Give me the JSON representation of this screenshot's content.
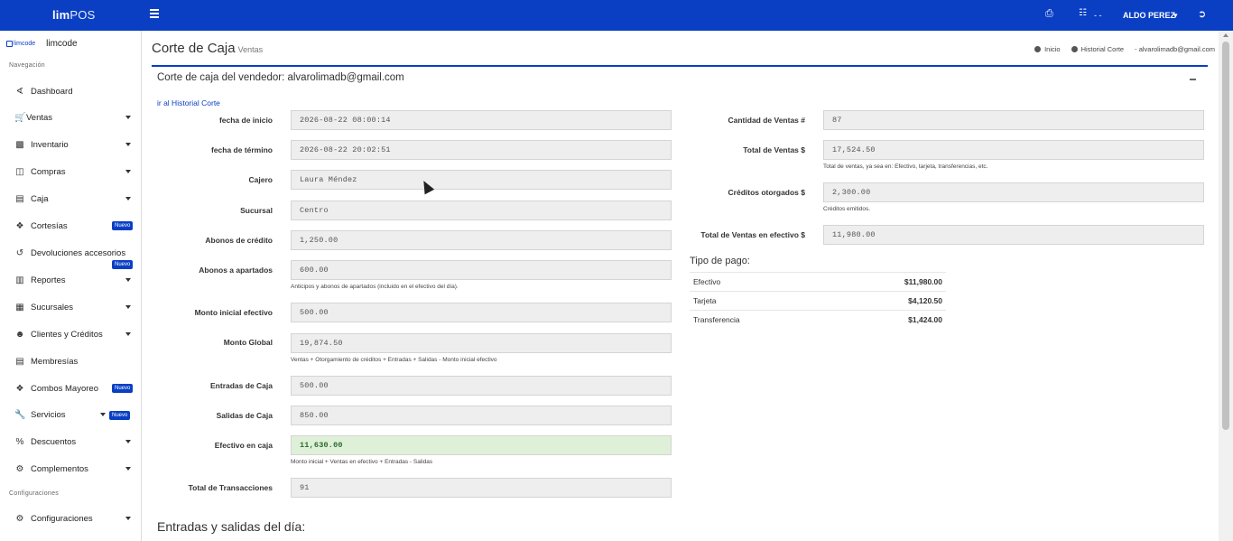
{
  "topbar": {
    "brand_bold": "lim",
    "brand_rest": "POS",
    "user": "ALDO PEREZ",
    "dots": "- -"
  },
  "sidebar": {
    "brand_logo": "limcode",
    "brand_name": "limcode",
    "nav_section": "Navegación",
    "config_section": "Configuraciones",
    "items": [
      {
        "label": "Dashboard",
        "icon": "chart-line-icon"
      },
      {
        "label": "Ventas",
        "icon": "cart-icon"
      },
      {
        "label": "Inventario",
        "icon": "boxes-icon"
      },
      {
        "label": "Compras",
        "icon": "basket-icon"
      },
      {
        "label": "Caja",
        "icon": "cash-register-icon"
      },
      {
        "label": "Cortesías",
        "icon": "gift-icon",
        "badge": "Nuevo"
      },
      {
        "label": "Devoluciones accesorios",
        "icon": "undo-icon",
        "badge": "Nuevo"
      },
      {
        "label": "Reportes",
        "icon": "bar-chart-icon"
      },
      {
        "label": "Sucursales",
        "icon": "building-icon"
      },
      {
        "label": "Clientes y Créditos",
        "icon": "users-icon"
      },
      {
        "label": "Membresías",
        "icon": "id-card-icon"
      },
      {
        "label": "Combos Mayoreo",
        "icon": "cubes-icon",
        "badge": "Nuevo"
      },
      {
        "label": "Servicios",
        "icon": "wrench-icon",
        "badge": "Nuevo"
      },
      {
        "label": "Descuentos",
        "icon": "percent-icon"
      },
      {
        "label": "Complementos",
        "icon": "gear-icon"
      },
      {
        "label": "Configuraciones",
        "icon": "cog-icon"
      }
    ]
  },
  "header": {
    "title": "Corte de Caja",
    "subtitle": "Ventas",
    "crumbs": [
      "Inicio",
      "Historial Corte",
      "alvarolimadb@gmail.com"
    ]
  },
  "card": {
    "title": "Corte de caja del vendedor: alvarolimadb@gmail.com",
    "history_link": "ir al Historial Corte"
  },
  "left_fields": [
    {
      "label": "fecha de inicio",
      "value": "2026-08-22 08:00:14"
    },
    {
      "label": "fecha de término",
      "value": "2026-08-22 20:02:51"
    },
    {
      "label": "Cajero",
      "value": "Laura Méndez"
    },
    {
      "label": "Sucursal",
      "value": "Centro"
    },
    {
      "label": "Abonos de crédito",
      "value": "1,250.00"
    },
    {
      "label": "Abonos a apartados",
      "value": "600.00",
      "help": "Anticipos y abonos de apartados (incluido en el efectivo del día)."
    },
    {
      "label": "Monto inicial efectivo",
      "value": "500.00"
    },
    {
      "label": "Monto Global",
      "value": "19,874.50",
      "help": "Ventas + Otorgamiento de créditos + Entradas + Salidas - Monto inicial efectivo"
    },
    {
      "label": "Entradas de Caja",
      "value": "500.00"
    },
    {
      "label": "Salidas de Caja",
      "value": "850.00"
    },
    {
      "label": "Efectivo en caja",
      "value": "11,630.00",
      "help": "Monto inicial + Ventas en efectivo + Entradas - Salidas"
    },
    {
      "label": "Total de Transacciones",
      "value": "91"
    }
  ],
  "right_fields": [
    {
      "label": "Cantidad de Ventas #",
      "value": "87"
    },
    {
      "label": "Total de Ventas $",
      "value": "17,524.50",
      "help": "Total de ventas, ya sea en: Efectivo, tarjeta, transferencias, etc."
    },
    {
      "label": "Créditos otorgados $",
      "value": "2,300.00",
      "help": "Créditos emitidos."
    },
    {
      "label": "Total de Ventas en efectivo $",
      "value": "11,980.00"
    }
  ],
  "payment": {
    "title": "Tipo de pago:",
    "rows": [
      {
        "method": "Efectivo",
        "amount": "$11,980.00"
      },
      {
        "method": "Tarjeta",
        "amount": "$4,120.50"
      },
      {
        "method": "Transferencia",
        "amount": "$1,424.00"
      }
    ]
  },
  "bottom_title": "Entradas y salidas del día:"
}
